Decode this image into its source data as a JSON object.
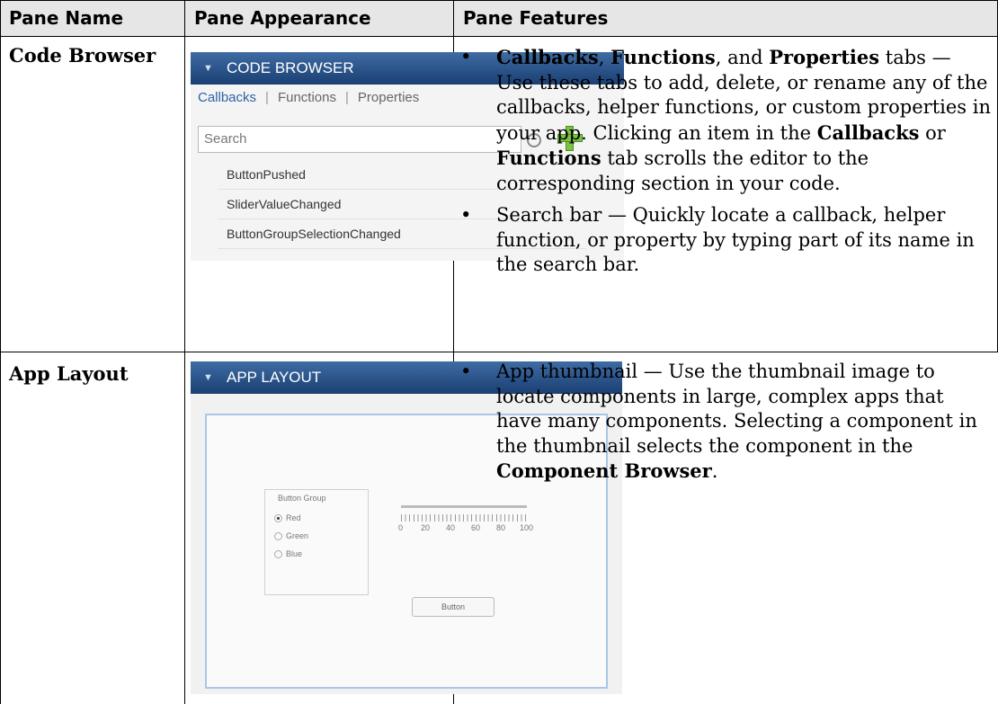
{
  "table": {
    "headers": [
      "Pane Name",
      "Pane Appearance",
      "Pane Features"
    ]
  },
  "rows": [
    {
      "name": "Code Browser",
      "features": [
        {
          "runs": [
            {
              "text": "Callbacks",
              "bold": true
            },
            {
              "text": ", ",
              "bold": false
            },
            {
              "text": "Functions",
              "bold": true
            },
            {
              "text": ", and ",
              "bold": false
            },
            {
              "text": "Properties",
              "bold": true
            },
            {
              "text": " tabs — Use these tabs to add, delete, or rename any of the callbacks, helper functions, or custom properties in your app. Clicking an item in the ",
              "bold": false
            },
            {
              "text": "Callbacks",
              "bold": true
            },
            {
              "text": " or ",
              "bold": false
            },
            {
              "text": "Functions",
              "bold": true
            },
            {
              "text": " tab scrolls the editor to the corresponding section in your code.",
              "bold": false
            }
          ]
        },
        {
          "runs": [
            {
              "text": "Search bar — Quickly locate a callback, helper function, or property by typing part of its name in the search bar.",
              "bold": false
            }
          ]
        }
      ]
    },
    {
      "name": "App Layout",
      "features": [
        {
          "runs": [
            {
              "text": "App thumbnail — Use the thumbnail image to locate components in large, complex apps that have many components. Selecting a component in the thumbnail selects the component in the ",
              "bold": false
            },
            {
              "text": "Component Browser",
              "bold": true
            },
            {
              "text": ".",
              "bold": false
            }
          ]
        }
      ]
    }
  ],
  "bullet": "•",
  "code_browser_image": {
    "title": "CODE BROWSER",
    "tabs": [
      "Callbacks",
      "Functions",
      "Properties"
    ],
    "tab_separator": "|",
    "search_placeholder": "Search",
    "items": [
      "ButtonPushed",
      "SliderValueChanged",
      "ButtonGroupSelectionChanged"
    ],
    "icons": [
      "collapse-triangle-icon",
      "search-icon",
      "add-plus-icon"
    ]
  },
  "app_layout_image": {
    "title": "APP LAYOUT",
    "group_title": "Button Group",
    "radio_options": [
      "Red",
      "Green",
      "Blue"
    ],
    "slider_ticks": [
      "0",
      "20",
      "40",
      "60",
      "80",
      "100"
    ],
    "button_label": "Button"
  },
  "colors": {
    "header_bg": "#e6e6e6",
    "pane_bar": "#2a5189",
    "tab_active": "#2f62a8",
    "plus_icon": "#7cc242"
  }
}
